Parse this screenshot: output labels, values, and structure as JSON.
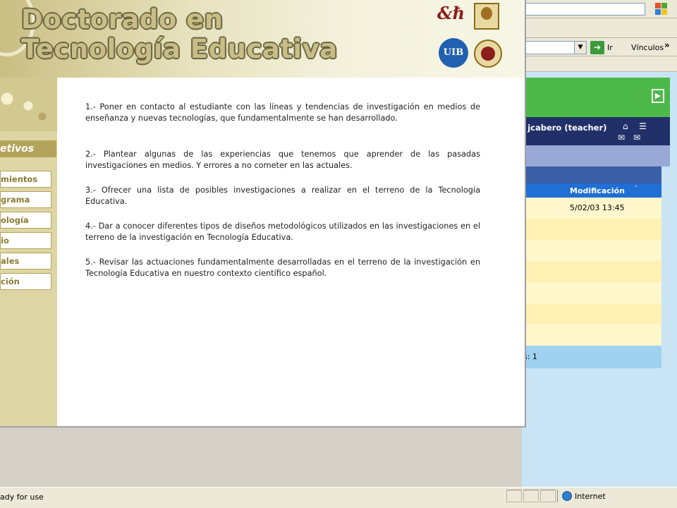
{
  "popup": {
    "banner_title_line1": "Doctorado en",
    "banner_title_line2": "Tecnología Educativa",
    "logos": [
      "logo-1-icon",
      "logo-2-icon",
      "uib-logo-icon",
      "logo-4-icon"
    ],
    "logo_uib_text": "UIB",
    "sidebar": {
      "section_title": "etivos",
      "items": [
        {
          "label": "mientos"
        },
        {
          "label": "grama"
        },
        {
          "label": "ología"
        },
        {
          "label": "io"
        },
        {
          "label": "ales"
        },
        {
          "label": "ción"
        }
      ]
    },
    "paragraphs": [
      "1.- Poner en contacto al estudiante con las líneas y tendencias de investigación en medios de enseñanza y nuevas tecnologías, que fundamentalmente se han desarrollado.",
      "2.- Plantear algunas de las experiencias que tenemos que aprender de las pasadas investigaciones en medios. Y errores a no cometer en las actuales.",
      "3.- Ofrecer una lista de posibles investigaciones a realizar en el terreno de la Tecnología Educativa.",
      "4.- Dar a conocer diferentes tipos de diseños metodológicos utilizados en las investigaciones en el terreno de la investigación en Tecnología Educativa.",
      "5.- Revisar las actuaciones fundamentalmente desarrolladas en el terreno de la investigación en Tecnología Educativa en nuestro contexto científico español."
    ]
  },
  "browser": {
    "go_label": "Ir",
    "links_label": "Vínculos",
    "links_chevron": "»",
    "user_label": "/ jcabero (teacher)",
    "table": {
      "column": "Modificación",
      "first_row_date": "5/02/03 13:45",
      "footer": "s: 1"
    },
    "status_text": "ady for use",
    "zone_label": "Internet"
  },
  "colors": {
    "banner_title_fill": "#c8bd86",
    "sidebar_accent": "#b4a35a",
    "green_bar": "#4cb848",
    "navy_bar": "#22306a",
    "table_header": "#1f6fd4"
  }
}
